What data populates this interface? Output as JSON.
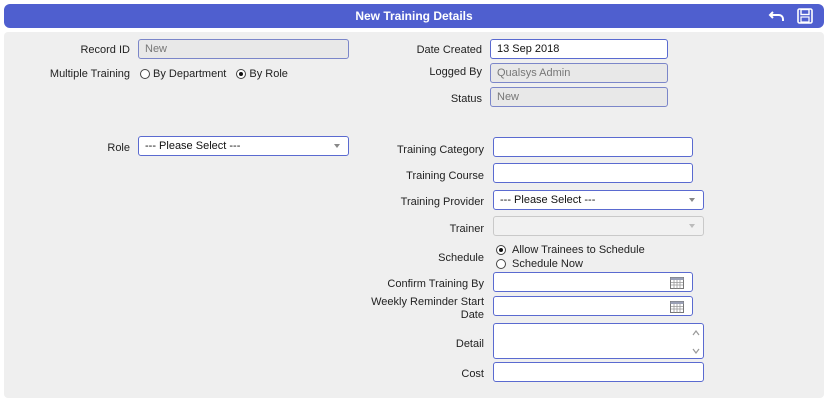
{
  "header": {
    "title": "New Training Details",
    "undo_icon": "undo-arrow-icon",
    "save_icon": "floppy-save-icon"
  },
  "left": {
    "record_id_label": "Record ID",
    "record_id_value": "New",
    "multiple_training_label": "Multiple Training",
    "by_department_label": "By Department",
    "by_role_label": "By Role",
    "selected_option": "By Role",
    "role_label": "Role",
    "role_value": "--- Please Select ---"
  },
  "right": {
    "date_created_label": "Date Created",
    "date_created_value": "13 Sep 2018",
    "logged_by_label": "Logged By",
    "logged_by_value": "Qualsys Admin",
    "status_label": "Status",
    "status_value": "New",
    "training_category_label": "Training Category",
    "training_category_value": "",
    "training_course_label": "Training Course",
    "training_course_value": "",
    "training_provider_label": "Training Provider",
    "training_provider_value": "--- Please Select ---",
    "trainer_label": "Trainer",
    "trainer_value": "",
    "schedule_label": "Schedule",
    "schedule_option_1": "Allow Trainees to Schedule",
    "schedule_option_2": "Schedule Now",
    "schedule_selected": "Allow Trainees to Schedule",
    "confirm_training_by_label": "Confirm Training By",
    "confirm_training_by_value": "",
    "weekly_reminder_label_1": "Weekly Reminder Start",
    "weekly_reminder_label_2": "Date",
    "weekly_reminder_value": "",
    "detail_label": "Detail",
    "detail_value": "",
    "cost_label": "Cost",
    "cost_value": ""
  },
  "colors": {
    "header_bg": "#4f5fcf",
    "panel_bg": "#efefef",
    "field_border": "#5a6ad0"
  }
}
